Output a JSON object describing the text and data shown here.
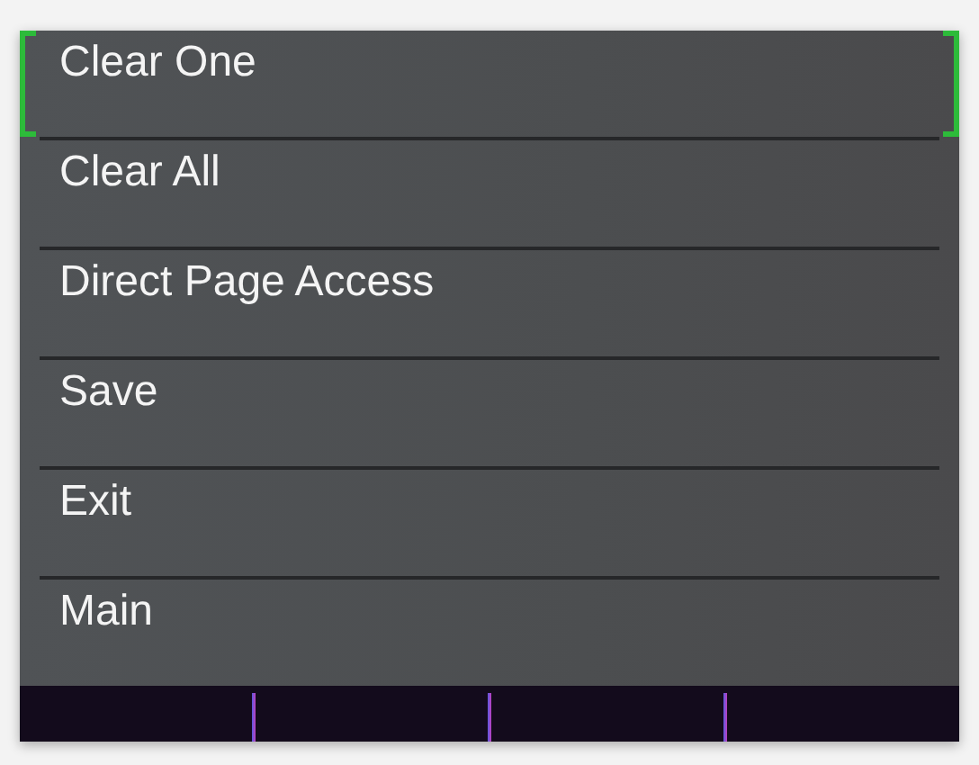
{
  "menu": {
    "items": [
      {
        "label": "Clear One",
        "selected": true
      },
      {
        "label": "Clear All",
        "selected": false
      },
      {
        "label": "Direct Page Access",
        "selected": false
      },
      {
        "label": "Save",
        "selected": false
      },
      {
        "label": "Exit",
        "selected": false
      },
      {
        "label": "Main",
        "selected": false
      }
    ]
  }
}
